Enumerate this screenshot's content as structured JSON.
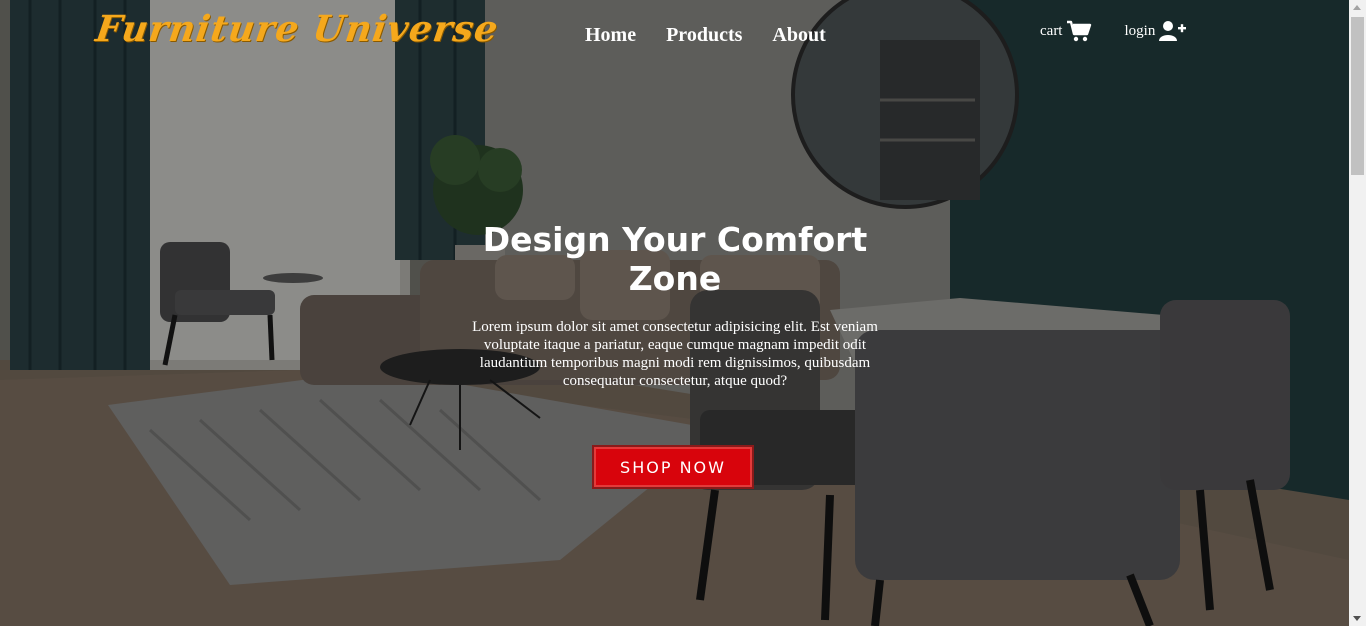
{
  "brand": {
    "logo": "Furniture Universe",
    "logo_color": "#f5a81c"
  },
  "nav": {
    "links": [
      {
        "label": "Home"
      },
      {
        "label": "Products"
      },
      {
        "label": "About"
      }
    ],
    "cart": {
      "label": "cart",
      "icon": "shopping-cart-icon"
    },
    "login": {
      "label": "login",
      "icon": "user-plus-icon"
    }
  },
  "hero": {
    "title": "Design Your Comfort Zone",
    "text": "Lorem ipsum dolor sit amet consectetur adipisicing elit. Est veniam voluptate itaque a pariatur, eaque cumque magnam impedit odit laudantium temporibus magni modi rem dignissimos, quibusdam consequatur consectetur, atque quod?",
    "button": "SHOP NOW",
    "button_color": "#d8040c"
  }
}
